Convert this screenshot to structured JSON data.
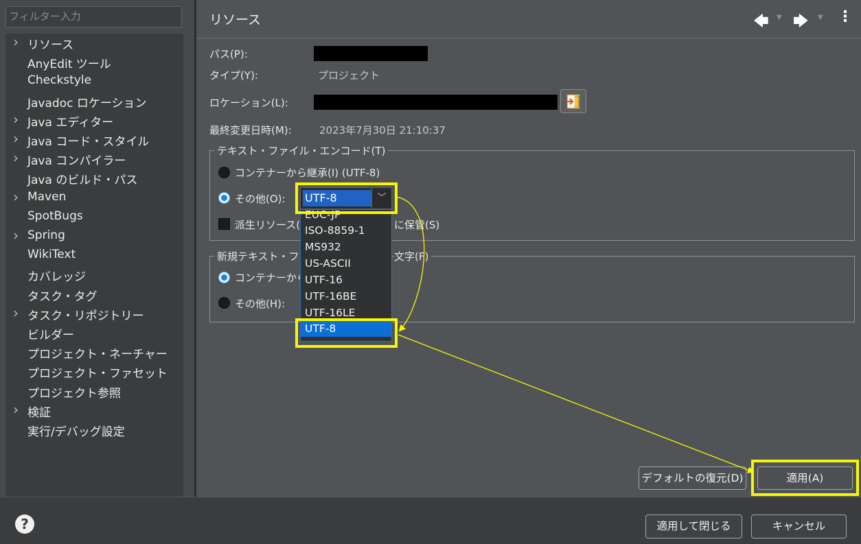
{
  "left": {
    "filter_placeholder": "フィルター入力",
    "tree": [
      {
        "label": "リソース",
        "expandable": true
      },
      {
        "label": "AnyEdit ツール",
        "expandable": false
      },
      {
        "label": "Checkstyle",
        "expandable": false
      },
      {
        "label": "Javadoc ロケーション",
        "expandable": false
      },
      {
        "label": "Java エディター",
        "expandable": true
      },
      {
        "label": "Java コード・スタイル",
        "expandable": true
      },
      {
        "label": "Java コンパイラー",
        "expandable": true
      },
      {
        "label": "Java のビルド・パス",
        "expandable": false
      },
      {
        "label": "Maven",
        "expandable": true
      },
      {
        "label": "SpotBugs",
        "expandable": false
      },
      {
        "label": "Spring",
        "expandable": true
      },
      {
        "label": "WikiText",
        "expandable": false
      },
      {
        "label": "カバレッジ",
        "expandable": false
      },
      {
        "label": "タスク・タグ",
        "expandable": false
      },
      {
        "label": "タスク・リポジトリー",
        "expandable": true
      },
      {
        "label": "ビルダー",
        "expandable": false
      },
      {
        "label": "プロジェクト・ネーチャー",
        "expandable": false
      },
      {
        "label": "プロジェクト・ファセット",
        "expandable": false
      },
      {
        "label": "プロジェクト参照",
        "expandable": false
      },
      {
        "label": "検証",
        "expandable": true
      },
      {
        "label": "実行/デバッグ設定",
        "expandable": false
      }
    ]
  },
  "page": {
    "title": "リソース",
    "path_label": "パス(P):",
    "type_label": "タイプ(Y):",
    "type_value": "プロジェクト",
    "location_label": "ロケーション(L):",
    "modified_label": "最終変更日時(M):",
    "modified_value": "2023年7月30日 21:10:37",
    "encoding_group": {
      "title": "テキスト・ファイル・エンコード(T)",
      "inherit_label": "コンテナーから継承(I) (UTF-8)",
      "other_label": "その他(O):",
      "combo_value": "UTF-8",
      "derived_label_a": "派生リソース(",
      "derived_label_b": "に保管(S)"
    },
    "newline_group": {
      "title_a": "新規テキスト・フ",
      "title_b": "文字(F)",
      "inherit_label": "コンテナーから",
      "other_label": "その他(H):"
    },
    "dropdown_items": [
      "EUC-JP",
      "ISO-8859-1",
      "MS932",
      "US-ASCII",
      "UTF-16",
      "UTF-16BE",
      "UTF-16LE",
      "UTF-8"
    ],
    "restore_defaults": "デフォルトの復元(D)",
    "apply": "適用(A)"
  },
  "footer": {
    "help": "?",
    "apply_close": "適用して閉じる",
    "cancel": "キャンセル"
  },
  "icons": {
    "back": "arrow-left-icon",
    "forward": "arrow-right-icon",
    "menu": "kebab-menu-icon",
    "help": "help-icon",
    "location": "open-location-icon"
  },
  "colors": {
    "highlight": "#f7f700",
    "selection": "#0d6fd6"
  }
}
